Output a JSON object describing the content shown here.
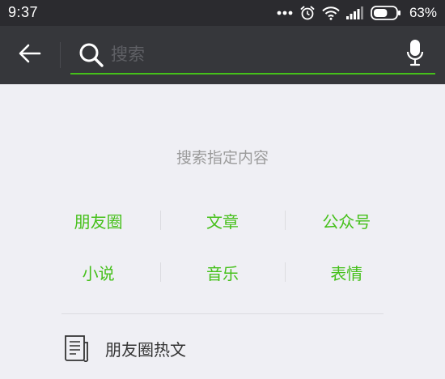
{
  "status_bar": {
    "time": "9:37",
    "battery_percent": "63%",
    "battery_level": 0.63
  },
  "search": {
    "placeholder": "搜索",
    "value": ""
  },
  "content": {
    "section_title": "搜索指定内容",
    "categories": [
      [
        "朋友圈",
        "文章",
        "公众号"
      ],
      [
        "小说",
        "音乐",
        "表情"
      ]
    ],
    "moments_articles_label": "朋友圈热文"
  },
  "colors": {
    "accent": "#45c01a",
    "header_bg": "#36373b",
    "status_bg": "#2b2b2f",
    "page_bg": "#efeff4"
  }
}
